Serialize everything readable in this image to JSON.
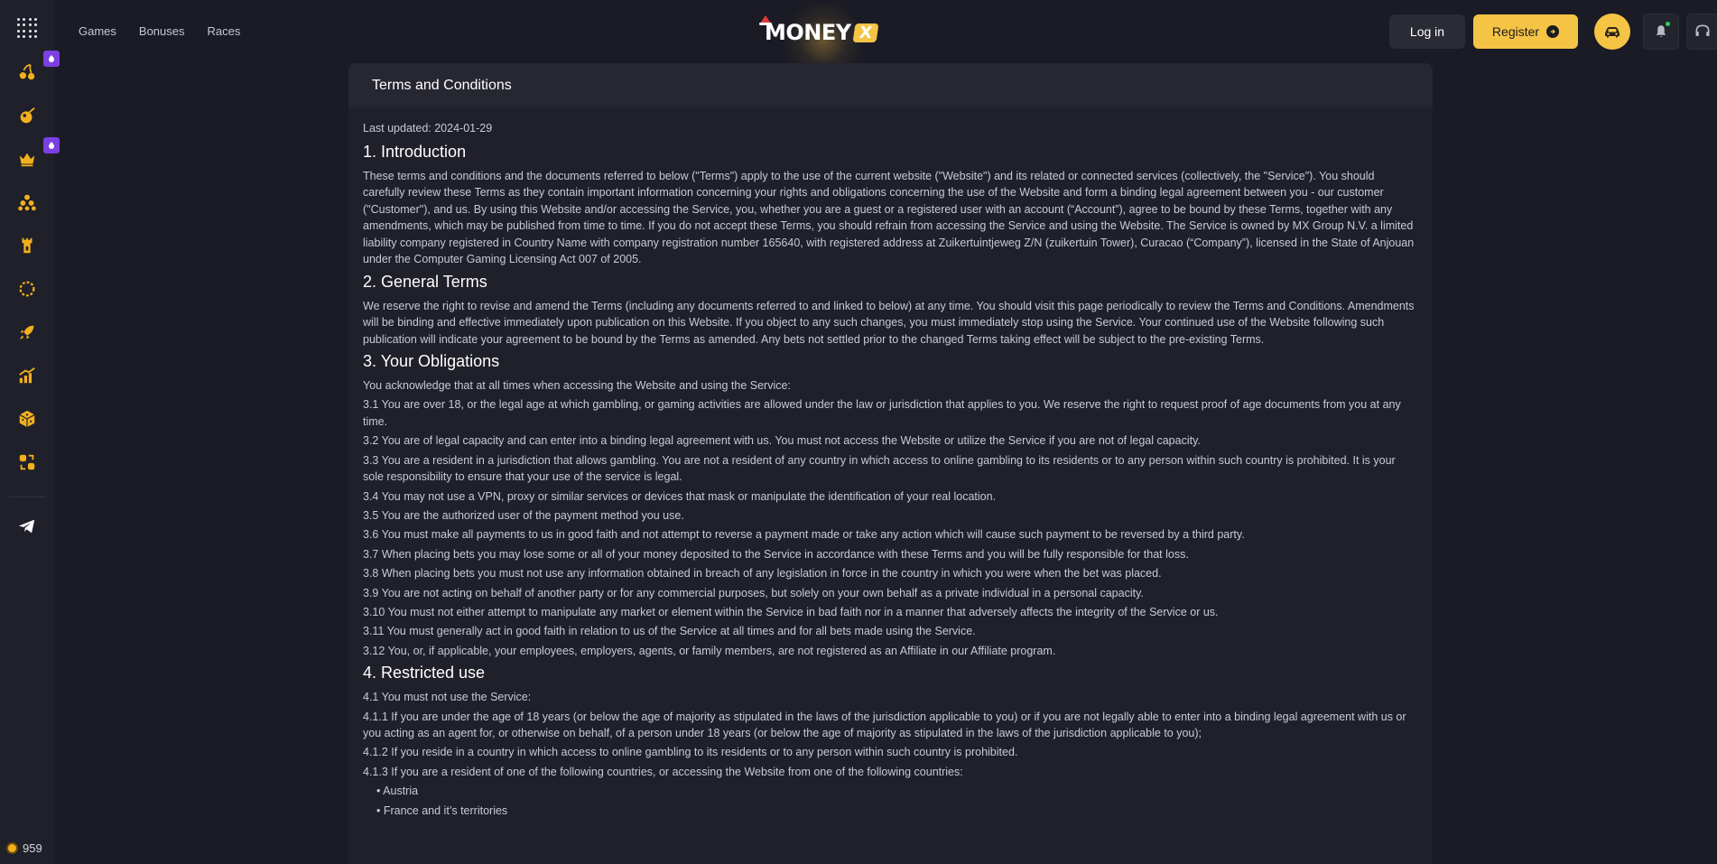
{
  "header": {
    "nav": [
      "Games",
      "Bonuses",
      "Races"
    ],
    "logo_text": "MONEY",
    "logo_x": "X",
    "login_label": "Log in",
    "register_label": "Register"
  },
  "sidebar": {
    "items": [
      {
        "icon": "cherry-icon",
        "badge": true
      },
      {
        "icon": "fire-ball-icon",
        "badge": false
      },
      {
        "icon": "crown-icon",
        "badge": true
      },
      {
        "icon": "balls-icon",
        "badge": false
      },
      {
        "icon": "castle-icon",
        "badge": false
      },
      {
        "icon": "roulette-icon",
        "badge": false
      },
      {
        "icon": "rocket-icon",
        "badge": false
      },
      {
        "icon": "chart-up-icon",
        "badge": false
      },
      {
        "icon": "dice-box-icon",
        "badge": false
      },
      {
        "icon": "slots-switch-icon",
        "badge": false
      }
    ],
    "telegram_icon": "telegram-icon",
    "balance": "959",
    "colors": {
      "icon": "#f2b01e",
      "badge": "#7b3fe4"
    }
  },
  "page": {
    "title": "Terms and Conditions",
    "last_updated": "Last updated: 2024-01-29",
    "s1_title": "1. Introduction",
    "s1_text": "These terms and conditions and the documents referred to below (\"Terms\") apply to the use of the current website (\"Website\") and its related or connected services (collectively, the \"Service\"). You should carefully review these Terms as they contain important information concerning your rights and obligations concerning the use of the Website and form a binding legal agreement between you - our customer (\"Customer\"), and us. By using this Website and/or accessing the Service, you, whether you are a guest or a registered user with an account (“Account”), agree to be bound by these Terms, together with any amendments, which may be published from time to time. If you do not accept these Terms, you should refrain from accessing the Service and using the Website. The Service is owned by MX Group N.V. a limited liability company registered in Country Name with company registration number 165640, with registered address at Zuikertuintjeweg Z/N (zuikertuin Tower), Curacao (“Company”), licensed in the State of Anjouan under the Computer Gaming Licensing Act 007 of 2005.",
    "s2_title": "2. General Terms",
    "s2_text": "We reserve the right to revise and amend the Terms (including any documents referred to and linked to below) at any time. You should visit this page periodically to review the Terms and Conditions. Amendments will be binding and effective immediately upon publication on this Website. If you object to any such changes, you must immediately stop using the Service. Your continued use of the Website following such publication will indicate your agreement to be bound by the Terms as amended. Any bets not settled prior to the changed Terms taking effect will be subject to the pre-existing Terms.",
    "s3_title": "3. Your Obligations",
    "s3_intro": "You acknowledge that at all times when accessing the Website and using the Service:",
    "s3_items": [
      "3.1 You are over 18, or the legal age at which gambling, or gaming activities are allowed under the law or jurisdiction that applies to you. We reserve the right to request proof of age documents from you at any time.",
      "3.2 You are of legal capacity and can enter into a binding legal agreement with us. You must not access the Website or utilize the Service if you are not of legal capacity.",
      "3.3 You are a resident in a jurisdiction that allows gambling. You are not a resident of any country in which access to online gambling to its residents or to any person within such country is prohibited. It is your sole responsibility to ensure that your use of the service is legal.",
      "3.4 You may not use a VPN, proxy or similar services or devices that mask or manipulate the identification of your real location.",
      "3.5 You are the authorized user of the payment method you use.",
      "3.6 You must make all payments to us in good faith and not attempt to reverse a payment made or take any action which will cause such payment to be reversed by a third party.",
      "3.7 When placing bets you may lose some or all of your money deposited to the Service in accordance with these Terms and you will be fully responsible for that loss.",
      "3.8 When placing bets you must not use any information obtained in breach of any legislation in force in the country in which you were when the bet was placed.",
      "3.9 You are not acting on behalf of another party or for any commercial purposes, but solely on your own behalf as a private individual in a personal capacity.",
      "3.10 You must not either attempt to manipulate any market or element within the Service in bad faith nor in a manner that adversely affects the integrity of the Service or us.",
      "3.11 You must generally act in good faith in relation to us of the Service at all times and for all bets made using the Service.",
      "3.12 You, or, if applicable, your employees, employers, agents, or family members, are not registered as an Affiliate in our Affiliate program."
    ],
    "s4_title": "4. Restricted use",
    "s4_items": [
      "4.1 You must not use the Service:",
      "4.1.1 If you are under the age of 18 years (or below the age of majority as stipulated in the laws of the jurisdiction applicable to you) or if you are not legally able to enter into a binding legal agreement with us or you acting as an agent for, or otherwise on behalf, of a person under 18 years (or below the age of majority as stipulated in the laws of the jurisdiction applicable to you);",
      "4.1.2 If you reside in a country in which access to online gambling to its residents or to any person within such country is prohibited.",
      "4.1.3 If you are a resident of one of the following countries, or accessing the Website from one of the following countries:"
    ],
    "s4_bullets": [
      "• Austria",
      "• France and it’s territories"
    ]
  }
}
